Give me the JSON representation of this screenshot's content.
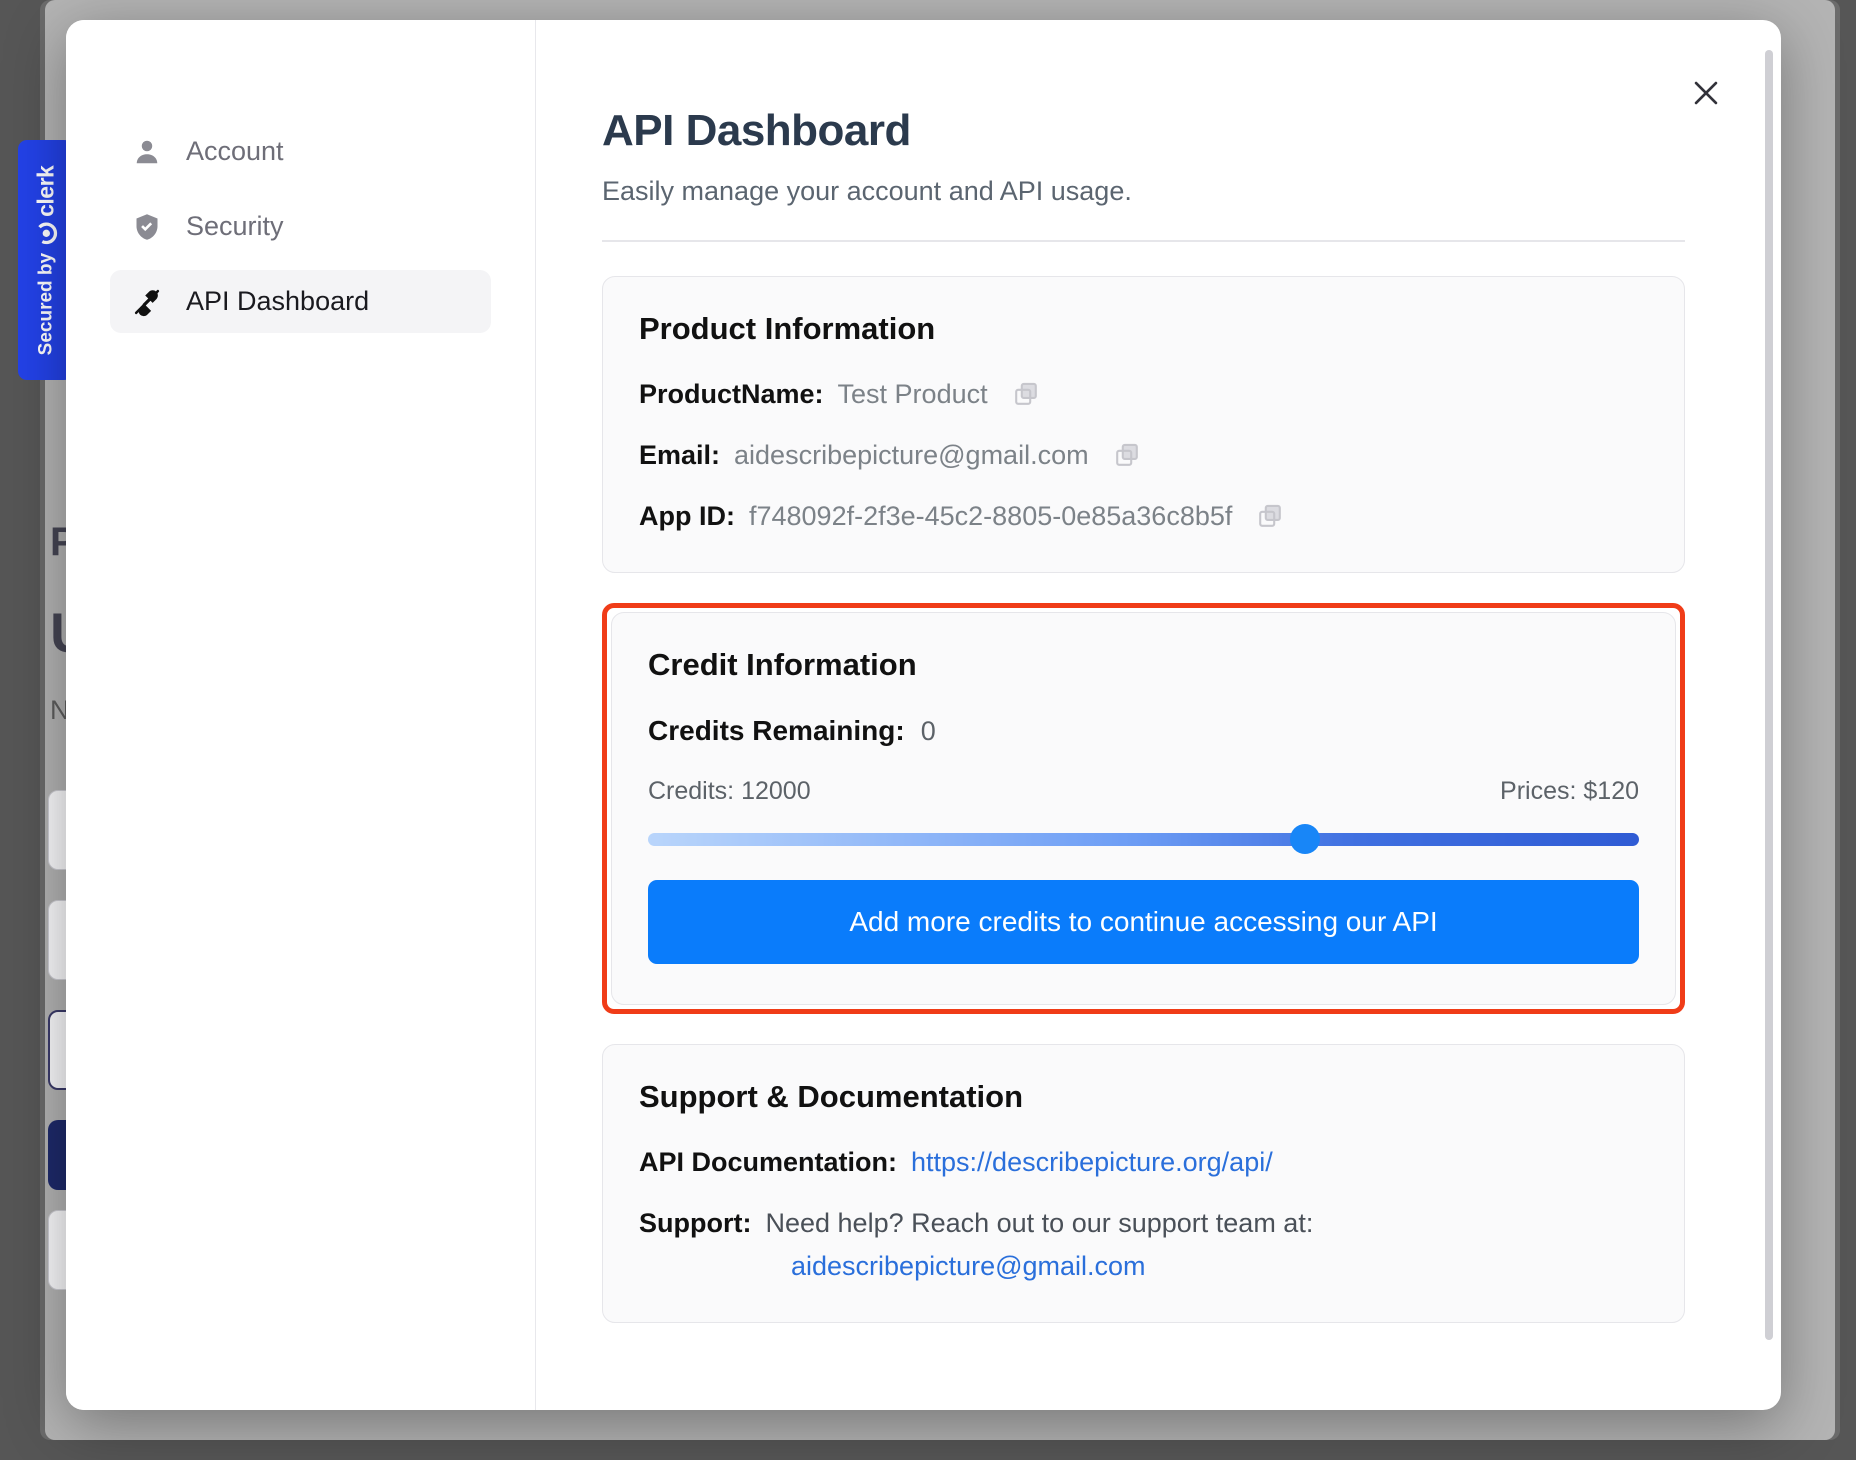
{
  "badge": {
    "secured_by": "Secured by",
    "brand": "clerk"
  },
  "behind": {
    "line1": "P",
    "line2": "U",
    "line3": "N"
  },
  "sidebar": {
    "items": [
      {
        "label": "Account",
        "icon": "user-icon",
        "active": false
      },
      {
        "label": "Security",
        "icon": "shield-check-icon",
        "active": false
      },
      {
        "label": "API Dashboard",
        "icon": "plug-icon",
        "active": true
      }
    ]
  },
  "header": {
    "title": "API Dashboard",
    "subtitle": "Easily manage your account and API usage.",
    "close_icon": "close-icon"
  },
  "product": {
    "title": "Product Information",
    "rows": [
      {
        "label": "ProductName:",
        "value": "Test Product",
        "copy": "copy-icon"
      },
      {
        "label": "Email:",
        "value": "aidescribepicture@gmail.com",
        "copy": "copy-icon"
      },
      {
        "label": "App ID:",
        "value": "f748092f-2f3e-45c2-8805-0e85a36c8b5f",
        "copy": "copy-icon"
      }
    ]
  },
  "credit": {
    "title": "Credit Information",
    "remaining_label": "Credits Remaining:",
    "remaining_value": "0",
    "credits_label": "Credits: 12000",
    "prices_label": "Prices: $120",
    "slider": {
      "value": 12000,
      "min": 0,
      "max": 18000,
      "percent": 66.3
    },
    "cta_label": "Add more credits to continue accessing our API",
    "highlight_color": "#f03c18",
    "accent_color": "#0a7cfb"
  },
  "support": {
    "title": "Support & Documentation",
    "doc_label": "API Documentation:",
    "doc_link": "https://describepicture.org/api/",
    "support_label": "Support:",
    "support_text": "Need help? Reach out to our support team at:",
    "support_email": "aidescribepicture@gmail.com"
  }
}
